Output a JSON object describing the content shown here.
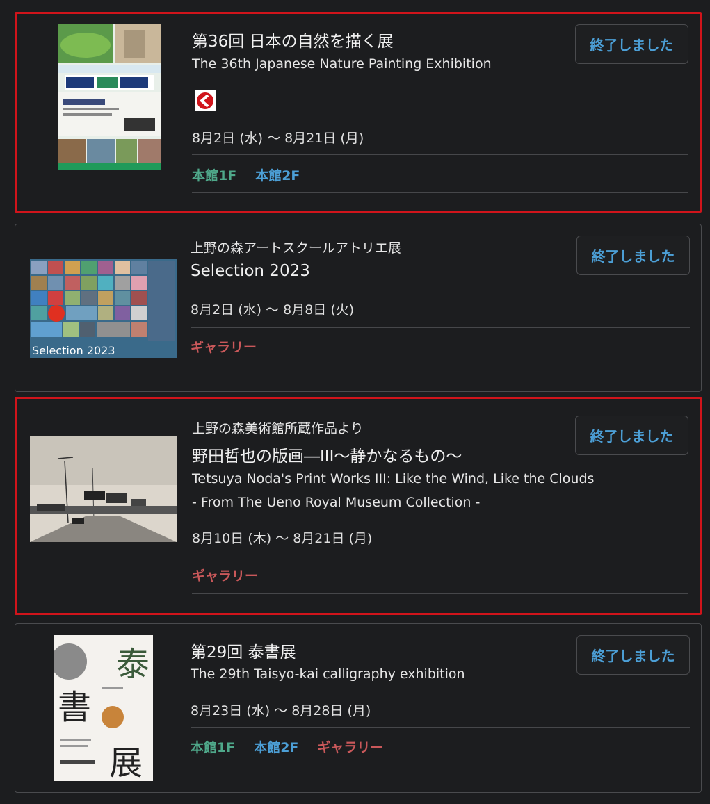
{
  "colors": {
    "background": "#1c1d1f",
    "highlight_border": "#d0141b",
    "status_text": "#4c9fd6",
    "loc_1f": "#4fa88a",
    "loc_2f": "#4c9fd6",
    "loc_gallery": "#c9585a"
  },
  "exhibitions": [
    {
      "title_jp": "第36回 日本の自然を描く展",
      "title_en": "The 36th Japanese Nature Painting Exhibition",
      "badge_icon": "red-circle-badge-icon",
      "date": "8月2日 (水) 〜 8月21日 (月)",
      "status": "終了しました",
      "locations": [
        "本館1F",
        "本館2F"
      ],
      "highlighted": true
    },
    {
      "subtitle_jp": "上野の森アートスクールアトリエ展",
      "title_jp": "Selection 2023",
      "date": "8月2日 (水) 〜 8月8日 (火)",
      "status": "終了しました",
      "locations": [
        "ギャラリー"
      ],
      "thumb_text": "Selection 2023",
      "highlighted": false
    },
    {
      "subtitle_jp": "上野の森美術館所蔵作品より",
      "title_jp": "野田哲也の版画―III〜静かなるもの〜",
      "title_en_line1": "Tetsuya Noda's Print Works III: Like the Wind, Like the Clouds",
      "title_en_line2": "- From The Ueno Royal Museum Collection -",
      "date": "8月10日 (木) 〜 8月21日 (月)",
      "status": "終了しました",
      "locations": [
        "ギャラリー"
      ],
      "highlighted": true
    },
    {
      "title_jp": "第29回 泰書展",
      "title_en": "The 29th Taisyo-kai calligraphy exhibition",
      "date": "8月23日 (水) 〜 8月28日 (月)",
      "status": "終了しました",
      "locations": [
        "本館1F",
        "本館2F",
        "ギャラリー"
      ],
      "thumb_chars": [
        "泰",
        "書",
        "展"
      ],
      "highlighted": false
    }
  ]
}
